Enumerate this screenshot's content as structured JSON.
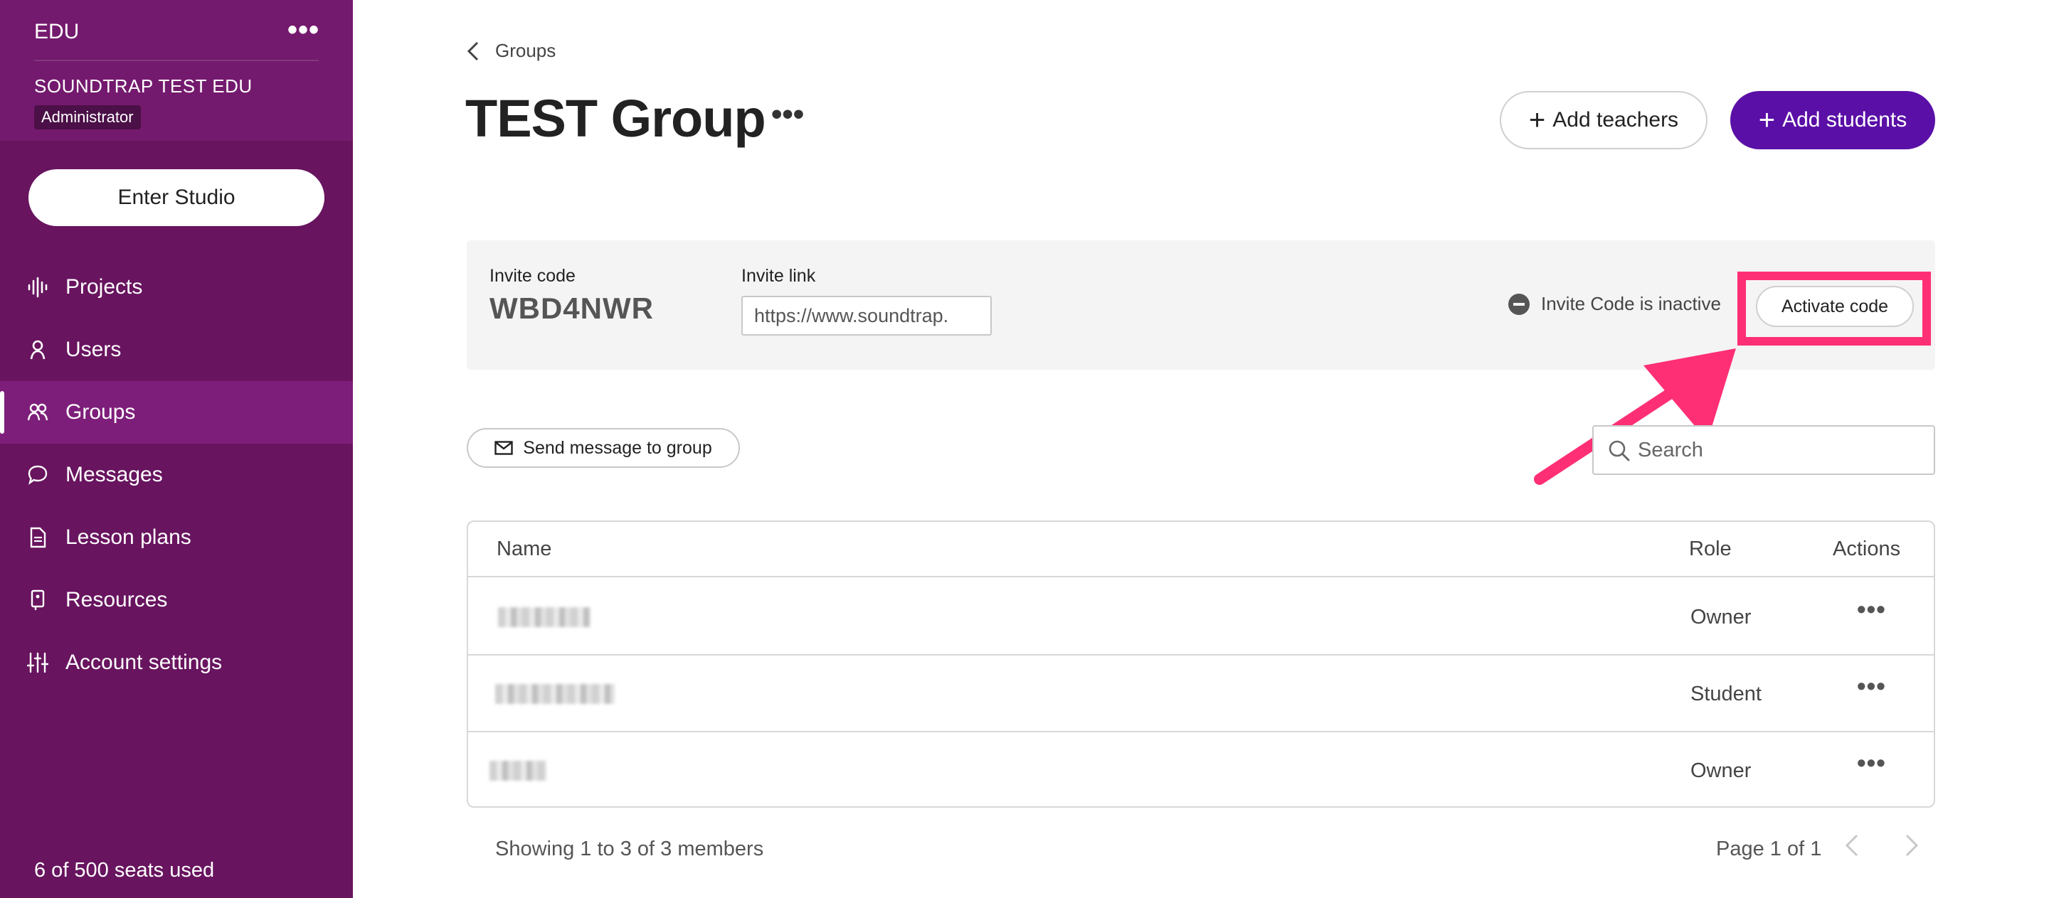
{
  "sidebar": {
    "edu_label": "EDU",
    "more": "•••",
    "org_name": "SOUNDTRAP TEST EDU",
    "role": "Administrator",
    "enter_studio": "Enter Studio",
    "items": [
      {
        "label": "Projects",
        "icon": "waveform-icon",
        "active": false
      },
      {
        "label": "Users",
        "icon": "user-icon",
        "active": false
      },
      {
        "label": "Groups",
        "icon": "users-group-icon",
        "active": true
      },
      {
        "label": "Messages",
        "icon": "chat-bubble-icon",
        "active": false
      },
      {
        "label": "Lesson plans",
        "icon": "document-icon",
        "active": false
      },
      {
        "label": "Resources",
        "icon": "bookmark-icon",
        "active": false
      },
      {
        "label": "Account settings",
        "icon": "sliders-icon",
        "active": false
      }
    ],
    "seats": "6 of 500 seats used"
  },
  "header": {
    "breadcrumb": "Groups",
    "title": "TEST Group",
    "title_more": "•••",
    "add_teachers": "Add teachers",
    "add_students": "Add students"
  },
  "invite": {
    "code_label": "Invite code",
    "code_value": "WBD4NWR",
    "link_label": "Invite link",
    "link_value": "https://www.soundtrap.",
    "status": "Invite Code is inactive",
    "activate": "Activate code"
  },
  "actions": {
    "send_message": "Send message to group",
    "search_placeholder": "Search"
  },
  "table": {
    "headers": {
      "name": "Name",
      "role": "Role",
      "actions": "Actions"
    },
    "rows": [
      {
        "role": "Owner"
      },
      {
        "role": "Student"
      },
      {
        "role": "Owner"
      }
    ],
    "row_more": "•••"
  },
  "footer": {
    "showing": "Showing 1 to 3 of 3 members",
    "page": "Page 1 of 1"
  },
  "colors": {
    "sidebar": "#68145f",
    "accent": "#5a0fa6",
    "highlight": "#ff2f75"
  }
}
